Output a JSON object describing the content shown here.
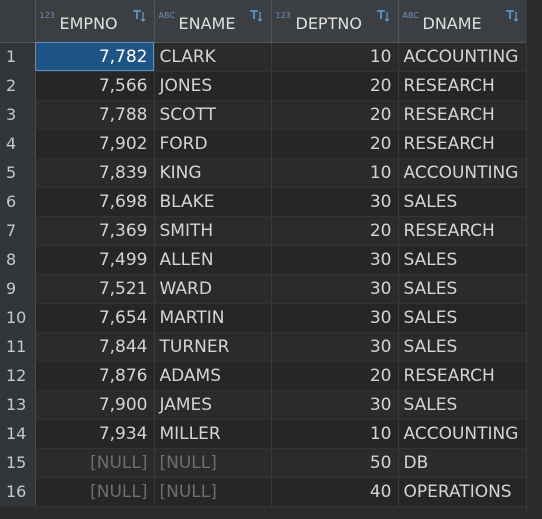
{
  "columns": [
    {
      "name": "EMPNO",
      "type_icon": "123"
    },
    {
      "name": "ENAME",
      "type_icon": "ABC"
    },
    {
      "name": "DEPTNO",
      "type_icon": "123"
    },
    {
      "name": "DNAME",
      "type_icon": "ABC"
    }
  ],
  "rows": [
    {
      "n": "1",
      "empno": "7,782",
      "ename": "CLARK",
      "deptno": "10",
      "dname": "ACCOUNTING"
    },
    {
      "n": "2",
      "empno": "7,566",
      "ename": "JONES",
      "deptno": "20",
      "dname": "RESEARCH"
    },
    {
      "n": "3",
      "empno": "7,788",
      "ename": "SCOTT",
      "deptno": "20",
      "dname": "RESEARCH"
    },
    {
      "n": "4",
      "empno": "7,902",
      "ename": "FORD",
      "deptno": "20",
      "dname": "RESEARCH"
    },
    {
      "n": "5",
      "empno": "7,839",
      "ename": "KING",
      "deptno": "10",
      "dname": "ACCOUNTING"
    },
    {
      "n": "6",
      "empno": "7,698",
      "ename": "BLAKE",
      "deptno": "30",
      "dname": "SALES"
    },
    {
      "n": "7",
      "empno": "7,369",
      "ename": "SMITH",
      "deptno": "20",
      "dname": "RESEARCH"
    },
    {
      "n": "8",
      "empno": "7,499",
      "ename": "ALLEN",
      "deptno": "30",
      "dname": "SALES"
    },
    {
      "n": "9",
      "empno": "7,521",
      "ename": "WARD",
      "deptno": "30",
      "dname": "SALES"
    },
    {
      "n": "10",
      "empno": "7,654",
      "ename": "MARTIN",
      "deptno": "30",
      "dname": "SALES"
    },
    {
      "n": "11",
      "empno": "7,844",
      "ename": "TURNER",
      "deptno": "30",
      "dname": "SALES"
    },
    {
      "n": "12",
      "empno": "7,876",
      "ename": "ADAMS",
      "deptno": "20",
      "dname": "RESEARCH"
    },
    {
      "n": "13",
      "empno": "7,900",
      "ename": "JAMES",
      "deptno": "30",
      "dname": "SALES"
    },
    {
      "n": "14",
      "empno": "7,934",
      "ename": "MILLER",
      "deptno": "10",
      "dname": "ACCOUNTING"
    },
    {
      "n": "15",
      "empno": "[NULL]",
      "ename": "[NULL]",
      "deptno": "50",
      "dname": "DB"
    },
    {
      "n": "16",
      "empno": "[NULL]",
      "ename": "[NULL]",
      "deptno": "40",
      "dname": "OPERATIONS"
    }
  ],
  "selected_row_index": 0,
  "null_marker": "[NULL]",
  "colors": {
    "background": "#2b2b2b",
    "header": "#3c3f41",
    "selection": "#1d5587",
    "type_icon": "#6c8fb8",
    "sort_icon": "#5aa0d8",
    "null_text": "#6e6e6e"
  }
}
